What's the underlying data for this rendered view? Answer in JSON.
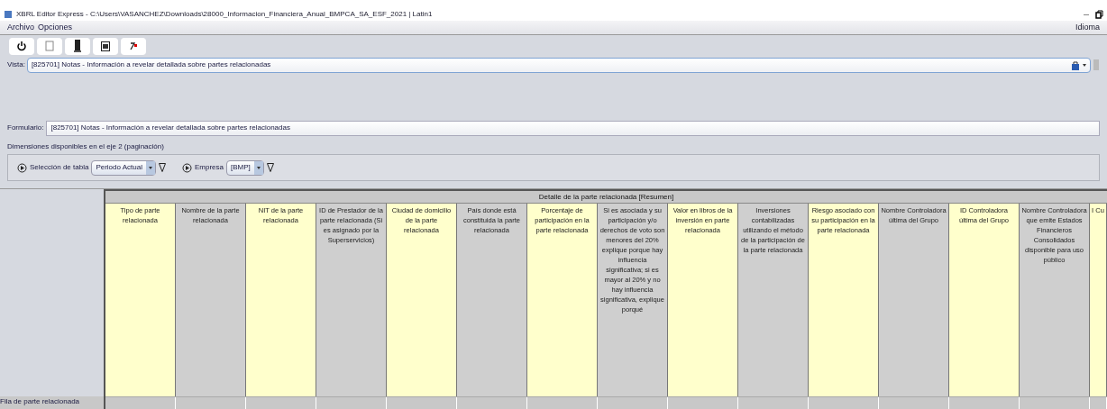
{
  "window": {
    "title": "XBRL Editor Express - C:\\Users\\VASANCHEZ\\Downloads\\28000_Informacion_Financiera_Anual_BMPCA_SA_ESF_2021 | Latin1"
  },
  "menu": [
    "Archivo",
    "Opciones"
  ],
  "menu_right": "Idioma",
  "vista": {
    "label": "Vista:",
    "value": "[825701] Notas - Información a revelar detallada sobre partes relacionadas"
  },
  "formulario": {
    "label": "Formulario:",
    "value": "[825701] Notas - Información a revelar detallada sobre partes relacionadas"
  },
  "dimensions_label": "Dimensiones disponibles en el eje 2 (paginación)",
  "selectors": [
    {
      "label": "Selección de tabla",
      "value": "Periodo Actual"
    },
    {
      "label": "Empresa",
      "value": "[BMP]"
    }
  ],
  "table": {
    "group_header": "Detalle de la parte relacionada [Resumen]",
    "columns": [
      {
        "label": "Tipo de parte relacionada",
        "editable": true
      },
      {
        "label": "Nombre de la parte relacionada",
        "editable": false
      },
      {
        "label": "NIT de la parte relacionada",
        "editable": true
      },
      {
        "label": "ID de Prestador de la parte relacionada (Si es asignado por la Superservicios)",
        "editable": false
      },
      {
        "label": "Ciudad de domicilio de la parte relacionada",
        "editable": true
      },
      {
        "label": "País donde está constituida la parte relacionada",
        "editable": false
      },
      {
        "label": "Porcentaje de participación en la parte relacionada",
        "editable": true
      },
      {
        "label": "Si es asociada y su participación y/o derechos de voto son menores del 20% explique porque hay influencia significativa; si es mayor al 20% y no hay influencia significativa, explique porqué",
        "editable": false
      },
      {
        "label": "Valor en libros de la inversión en parte relacionada",
        "editable": true
      },
      {
        "label": "Inversiones contabilizadas utilizando el método de la participación de la parte relacionada",
        "editable": false
      },
      {
        "label": "Riesgo asociado con su participación en la parte relacionada",
        "editable": true
      },
      {
        "label": "Nombre Controladora última del Grupo",
        "editable": false
      },
      {
        "label": "ID Controladora última del Grupo",
        "editable": true
      },
      {
        "label": "Nombre Controladora que emite Estados Financieros Consolidados disponible para uso público",
        "editable": false
      },
      {
        "label": "I Cu",
        "editable": true
      }
    ],
    "row_label": "Fila de parte relacionada"
  }
}
